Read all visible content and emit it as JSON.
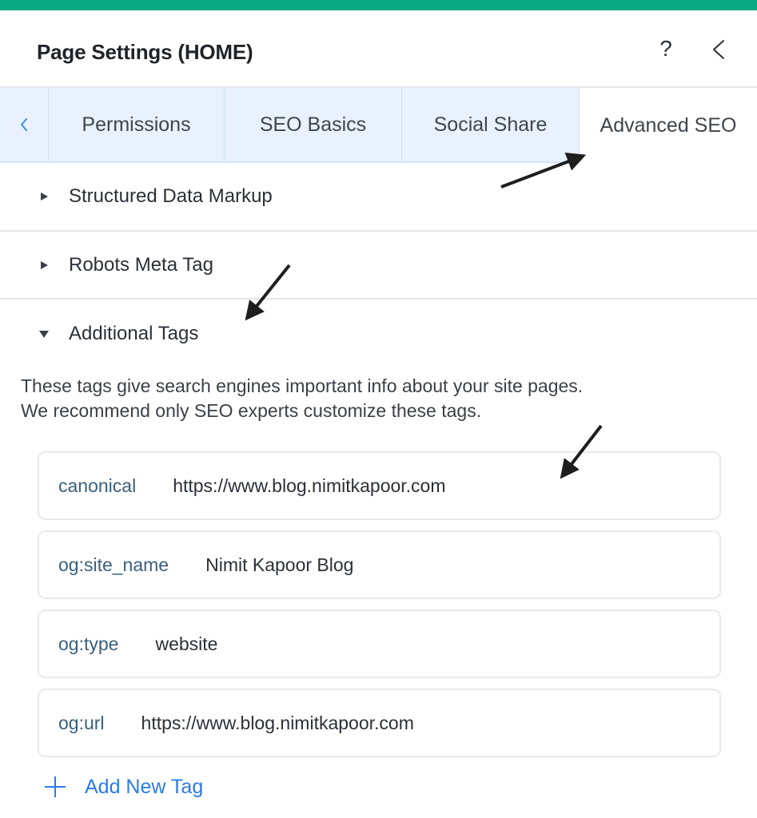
{
  "colors": {
    "top_bar": "#07a882",
    "tab_bg": "#e8f1fd",
    "accent_blue": "#2b7bea",
    "tag_key": "#3a5f7c"
  },
  "header": {
    "title": "Page Settings (HOME)",
    "help_icon": "?",
    "back_icon": "chevron-left-icon"
  },
  "tabs": {
    "scroll_left_icon": "chevron-left-icon",
    "items": [
      {
        "label": "Permissions",
        "active": false
      },
      {
        "label": "SEO Basics",
        "active": false
      },
      {
        "label": "Social Share",
        "active": false
      },
      {
        "label": "Advanced SEO",
        "active": true
      }
    ]
  },
  "sections": [
    {
      "label": "Structured Data Markup",
      "expanded": false
    },
    {
      "label": "Robots Meta Tag",
      "expanded": false
    },
    {
      "label": "Additional Tags",
      "expanded": true
    }
  ],
  "additional_tags": {
    "description_line1": "These tags give search engines important info about your site pages.",
    "description_line2": "We recommend only SEO experts customize these tags.",
    "tags": [
      {
        "key": "canonical",
        "value": "https://www.blog.nimitkapoor.com"
      },
      {
        "key": "og:site_name",
        "value": "Nimit Kapoor Blog"
      },
      {
        "key": "og:type",
        "value": "website"
      },
      {
        "key": "og:url",
        "value": "https://www.blog.nimitkapoor.com"
      }
    ],
    "add_label": "Add New Tag"
  }
}
